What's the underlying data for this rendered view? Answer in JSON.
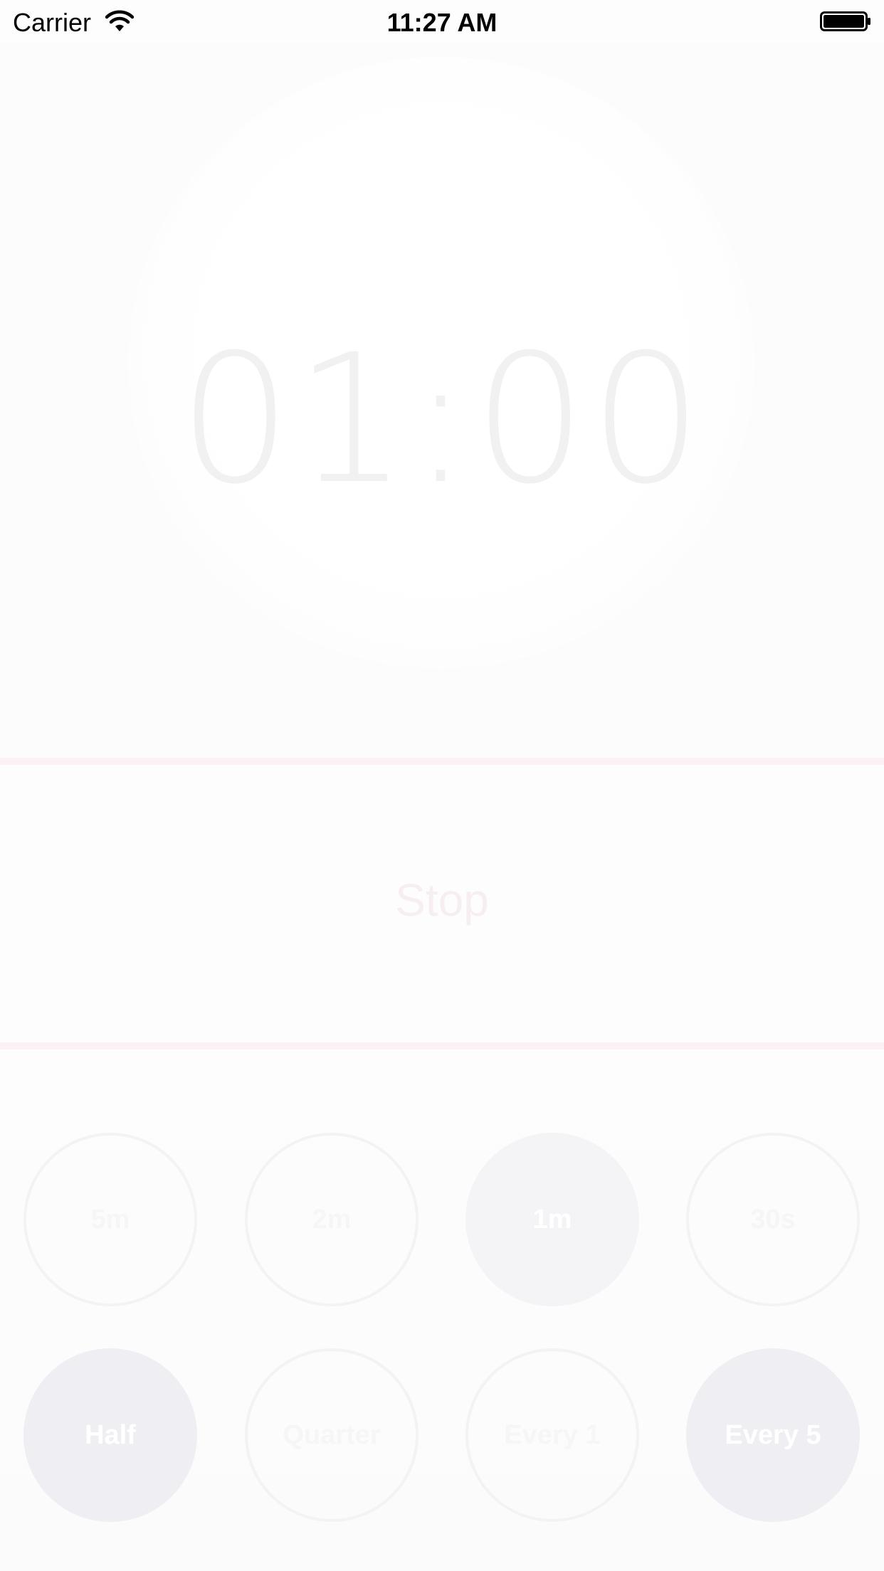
{
  "status_bar": {
    "carrier": "Carrier",
    "time": "11:27 AM",
    "wifi_icon": "wifi-icon",
    "battery_icon": "battery-icon"
  },
  "timer": {
    "display": "01:00"
  },
  "controls": {
    "stop_label": "Stop"
  },
  "interval_options": [
    {
      "label": "5m",
      "selected": false
    },
    {
      "label": "2m",
      "selected": false
    },
    {
      "label": "1m",
      "selected": true
    },
    {
      "label": "30s",
      "selected": false
    }
  ],
  "alert_options": [
    {
      "label": "Half",
      "selected": true
    },
    {
      "label": "Quarter",
      "selected": false
    },
    {
      "label": "Every 1",
      "selected": false
    },
    {
      "label": "Every 5",
      "selected": true
    }
  ],
  "colors": {
    "background": "#fdfdfd",
    "timer_text": "#f1f1f1",
    "separator": "#faf2f3",
    "selected_fill": "#efeff3",
    "circle_outline": "#f3f3f3"
  }
}
